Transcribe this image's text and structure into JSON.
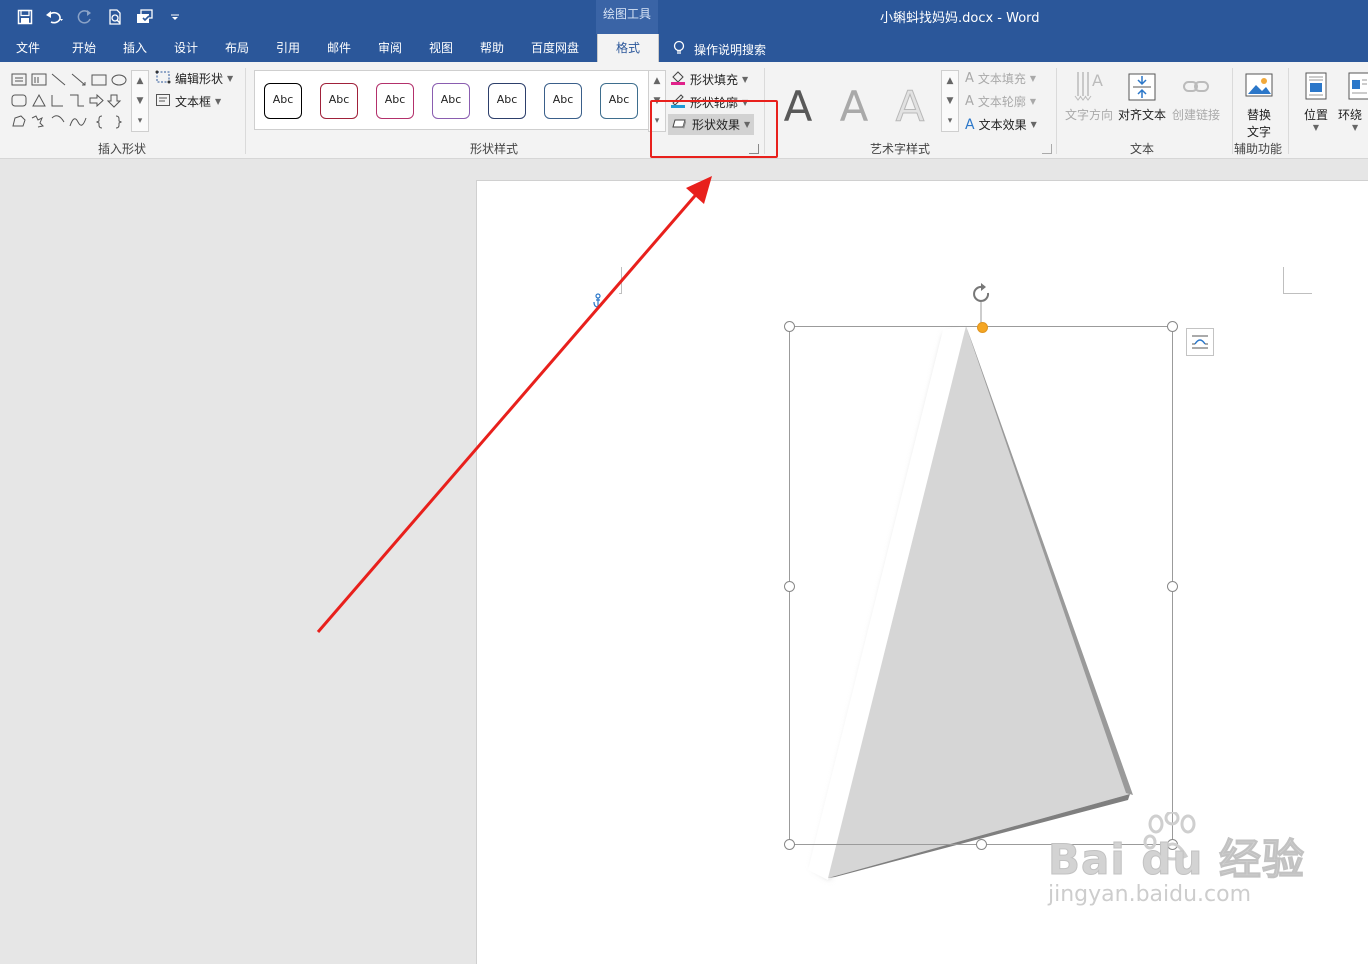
{
  "titlebar": {
    "contextual_tool": "绘图工具",
    "document_title": "小蝌蚪找妈妈.docx  -  Word"
  },
  "tabs": [
    {
      "label": "文件"
    },
    {
      "label": "开始"
    },
    {
      "label": "插入"
    },
    {
      "label": "设计"
    },
    {
      "label": "布局"
    },
    {
      "label": "引用"
    },
    {
      "label": "邮件"
    },
    {
      "label": "审阅"
    },
    {
      "label": "视图"
    },
    {
      "label": "帮助"
    },
    {
      "label": "百度网盘"
    },
    {
      "label": "格式"
    }
  ],
  "tell_me": "操作说明搜索",
  "ribbon": {
    "insert_shapes": {
      "label": "插入形状",
      "edit_shape": "编辑形状",
      "text_box": "文本框"
    },
    "shape_styles": {
      "label": "形状样式",
      "style_thumbs": [
        {
          "text": "Abc",
          "color": "#000000"
        },
        {
          "text": "Abc",
          "color": "#a0213a"
        },
        {
          "text": "Abc",
          "color": "#b3306b"
        },
        {
          "text": "Abc",
          "color": "#8a5db0"
        },
        {
          "text": "Abc",
          "color": "#2d3f6b"
        },
        {
          "text": "Abc",
          "color": "#3a5f8a"
        },
        {
          "text": "Abc",
          "color": "#3e6e8e"
        }
      ],
      "shape_fill": "形状填充",
      "shape_outline": "形状轮廓",
      "shape_effects": "形状效果"
    },
    "wordart_styles": {
      "label": "艺术字样式",
      "letters": [
        "A",
        "A",
        "A"
      ],
      "text_fill": "文本填充",
      "text_outline": "文本轮廓",
      "text_effects": "文本效果"
    },
    "text": {
      "label": "文本",
      "text_direction": "文字方向",
      "align_text": "对齐文本",
      "create_link": "创建链接"
    },
    "accessibility": {
      "label": "辅助功能",
      "alt_text_line1": "替换",
      "alt_text_line2": "文字"
    },
    "arrange": {
      "position": "位置",
      "wrap_text": "环绕"
    }
  },
  "watermark": {
    "main": "Bai du 经验",
    "url": "jingyan.baidu.com"
  },
  "colors": {
    "word_blue": "#2b579a",
    "annotation_red": "#e8201c",
    "handle_orange": "#f5a623"
  }
}
